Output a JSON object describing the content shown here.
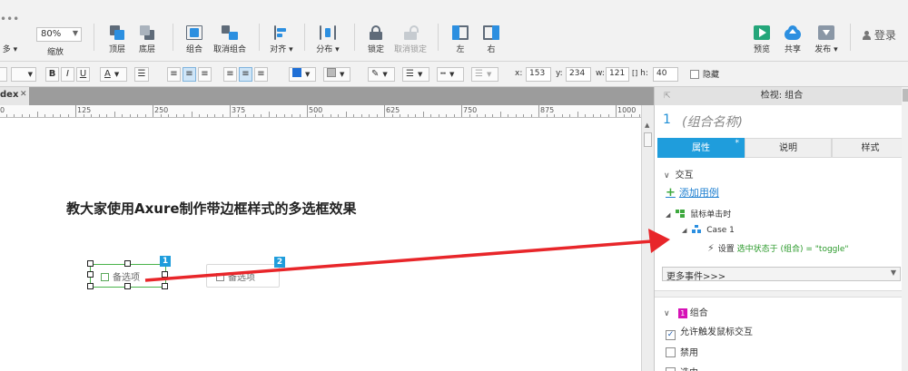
{
  "toolbar": {
    "partial_left_label": "多",
    "zoom": {
      "value": "80%",
      "label": "缩放"
    },
    "buttons": [
      {
        "label": "顶层"
      },
      {
        "label": "底层"
      },
      {
        "label": "组合"
      },
      {
        "label": "取消组合"
      },
      {
        "label": "对齐"
      },
      {
        "label": "分布"
      },
      {
        "label": "锁定"
      },
      {
        "label": "取消锁定"
      },
      {
        "label": "左"
      },
      {
        "label": "右"
      },
      {
        "label": "预览"
      },
      {
        "label": "共享"
      },
      {
        "label": "发布"
      }
    ],
    "login": "登录",
    "accent_colors": {
      "green": "#24a67a",
      "blue": "#2c8fe0",
      "gray_icon": "#5f6b79"
    }
  },
  "format_bar": {
    "bold": "B",
    "italic": "I",
    "underline": "U",
    "font_color": "A",
    "x_label": "x:",
    "x_value": "153",
    "y_label": "y:",
    "y_value": "234",
    "w_label": "w:",
    "w_value": "121",
    "h_label": "h:",
    "h_value": "40",
    "hidden_label": "隐藏"
  },
  "canvas": {
    "tab_label": "dex",
    "ruler_labels": [
      "0",
      "125",
      "250",
      "375",
      "500",
      "625",
      "750",
      "875",
      "1000"
    ],
    "heading": "教大家使用Axure制作带边框样式的多选框效果",
    "checkbox1": {
      "label": "备选项",
      "badge": "1"
    },
    "checkbox2": {
      "label": "备选项",
      "badge": "2"
    },
    "selection_color": "#49b34a",
    "arrow_color": "#e8262a"
  },
  "panel": {
    "header": "检视: 组合",
    "group_number": "1",
    "group_name": "(组合名称)",
    "tabs": [
      {
        "label": "属性",
        "active": true,
        "marker": "*"
      },
      {
        "label": "说明",
        "active": false
      },
      {
        "label": "样式",
        "active": false
      }
    ],
    "interaction_title": "交互",
    "add_case": "添加用例",
    "event": "鼠标单击时",
    "case": "Case 1",
    "action_prefix": "设置",
    "action_detail": "选中状态于 (组合) = \"toggle\"",
    "more_events": "更多事件>>>",
    "group_section_badge": "1",
    "group_section_title": "组合",
    "options": [
      {
        "label": "允许触发鼠标交互",
        "checked": true
      },
      {
        "label": "禁用",
        "checked": false
      },
      {
        "label": "选中",
        "checked": false
      }
    ],
    "accent": "#1f9ddc"
  }
}
